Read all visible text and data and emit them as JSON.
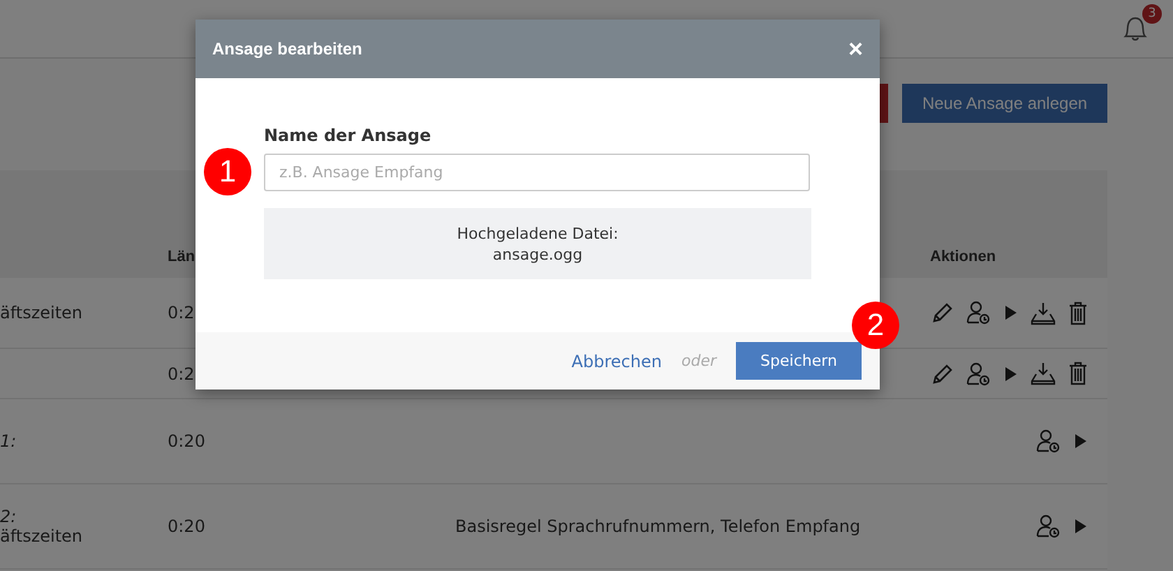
{
  "header": {
    "notifications": "3"
  },
  "toolbar": {
    "new_button": "Neue Ansage anlegen"
  },
  "table": {
    "columns": [
      "Län",
      "Aktionen"
    ],
    "rows": [
      {
        "name_lines": [
          {
            "text": "äftszeiten",
            "italic": false
          }
        ],
        "length": "0:2",
        "actions": [
          {
            "kind": "edit"
          },
          {
            "kind": "assign"
          },
          {
            "kind": "play"
          },
          {
            "kind": "download"
          },
          {
            "kind": "delete"
          }
        ]
      },
      {
        "name_lines": [],
        "length": "0:2",
        "actions": [
          {
            "kind": "edit"
          },
          {
            "kind": "assign"
          },
          {
            "kind": "play"
          },
          {
            "kind": "download"
          },
          {
            "kind": "delete"
          }
        ]
      },
      {
        "name_lines": [
          {
            "text": "1:",
            "italic": true
          }
        ],
        "length": "0:20",
        "actions": [
          {
            "kind": "assign"
          },
          {
            "kind": "play"
          }
        ]
      },
      {
        "name_lines": [
          {
            "text": "2:",
            "italic": true
          },
          {
            "text": "äftszeiten",
            "italic": false
          }
        ],
        "length": "0:20",
        "rule": "Basisregel Sprachrufnummern, Telefon Empfang",
        "actions": [
          {
            "kind": "assign"
          },
          {
            "kind": "play"
          }
        ]
      }
    ]
  },
  "dialog": {
    "title": "Ansage bearbeiten",
    "close": "×",
    "field_label": "Name der Ansage",
    "placeholder": "z.B. Ansage Empfang",
    "file_caption": "Hochgeladene Datei:",
    "file_name": "ansage.ogg",
    "cancel": "Abbrechen",
    "separator": "oder",
    "save": "Speichern"
  },
  "markers": [
    "1",
    "2"
  ]
}
